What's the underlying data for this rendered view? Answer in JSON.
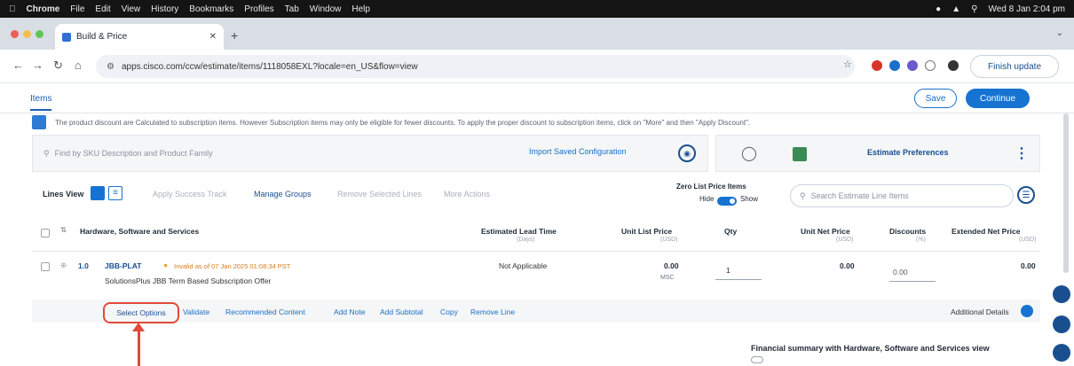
{
  "macos_menubar": {
    "app": "Chrome",
    "menus": [
      "File",
      "Edit",
      "View",
      "History",
      "Bookmarks",
      "Profiles",
      "Tab",
      "Window",
      "Help"
    ],
    "clock": "Wed 8 Jan 2:04 pm"
  },
  "browser": {
    "tab_title": "Build & Price",
    "url": "apps.cisco.com/ccw/estimate/items/1118058EXL?locale=en_US&flow=view",
    "finish_update": "Finish update"
  },
  "page": {
    "tab_items": "Items",
    "save": "Save",
    "continue": "Continue",
    "notice": "The product discount are Calculated to subscription items. However Subscription items may only be eligible for fewer discounts. To apply the proper discount to subscription items, click on \"More\" and then \"Apply Discount\".",
    "search_placeholder": "Find by SKU Description and Product Family",
    "import_saved": "Import Saved Configuration",
    "estimate_preferences": "Estimate Preferences",
    "lines_view": "Lines View",
    "apply_success_track": "Apply Success Track",
    "manage_groups": "Manage Groups",
    "remove_selected": "Remove Selected Lines",
    "more_actions": "More Actions",
    "zero_list_price": "Zero List Price Items",
    "hide": "Hide",
    "show": "Show",
    "search_estimate_placeholder": "Search Estimate Line Items"
  },
  "table": {
    "headers": [
      {
        "label": "Hardware, Software and Services",
        "sub": ""
      },
      {
        "label": "Estimated Lead Time",
        "sub": "(Days)"
      },
      {
        "label": "Unit List Price",
        "sub": "(USD)"
      },
      {
        "label": "Qty",
        "sub": ""
      },
      {
        "label": "Unit Net Price",
        "sub": "(USD)"
      },
      {
        "label": "Discounts",
        "sub": "(%)"
      },
      {
        "label": "Extended Net Price",
        "sub": "(USD)"
      }
    ],
    "rows": [
      {
        "line": "1.0",
        "sku": "JBB-PLAT",
        "status": "Invalid as of 07 Jan 2025 01:08:34 PST",
        "description": "SolutionsPlus JBB Term Based Subscription Offer",
        "lead_time": "Not Applicable",
        "unit_list_price": "0.00",
        "unit_list_note": "MSC",
        "qty": "1",
        "unit_net_price": "0.00",
        "discount": "0.00",
        "extended_net_price": "0.00"
      }
    ],
    "row_actions": [
      "Select Options",
      "Validate",
      "Recommended Content",
      "Add Note",
      "Add Subtotal",
      "Copy",
      "Remove Line"
    ],
    "additional_details": "Additional Details"
  },
  "financial_summary": "Financial summary with Hardware, Software and Services view",
  "colors": {
    "accent": "#1673d1",
    "callout": "#e04a3a"
  }
}
